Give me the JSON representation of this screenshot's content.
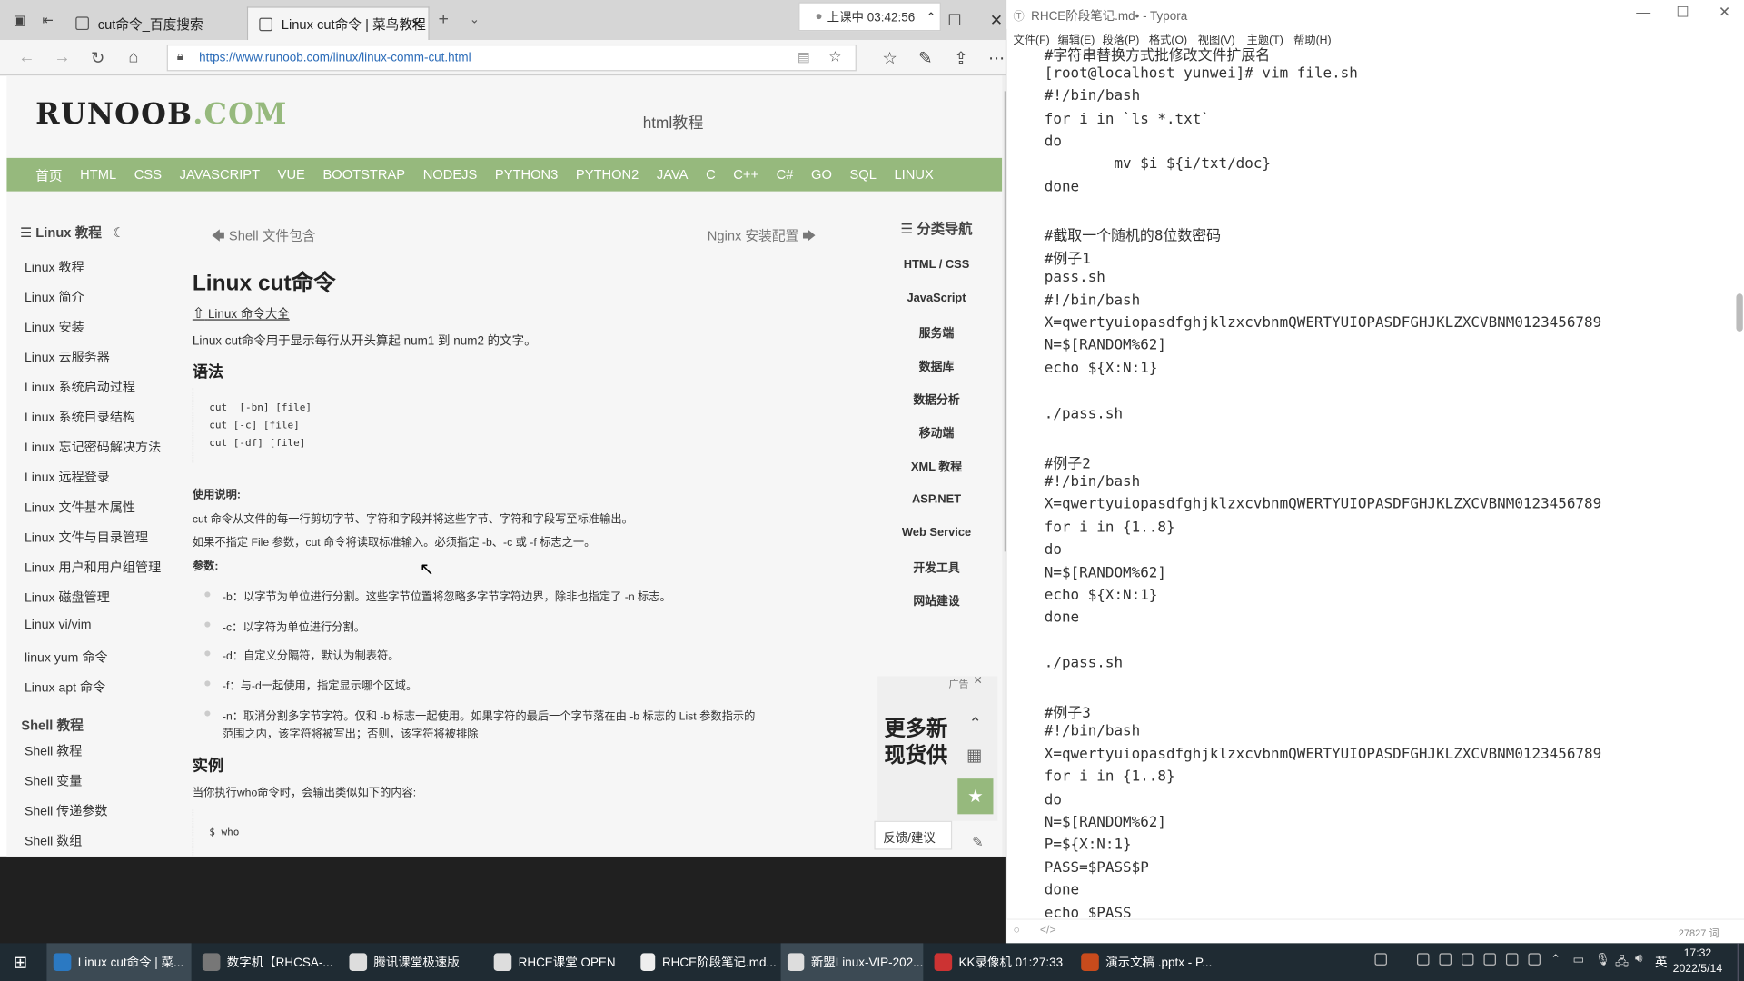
{
  "browser": {
    "tabs": [
      {
        "label": "cut命令_百度搜索"
      },
      {
        "label": "Linux cut命令 | 菜鸟教程"
      }
    ],
    "timer": "上课中 03:42:56",
    "url": "https://www.runoob.com/linux/linux-comm-cut.html"
  },
  "site": {
    "logo_main": "RUNOOB",
    "logo_suffix": ".COM",
    "header_link": "html教程",
    "nav": [
      "首页",
      "HTML",
      "CSS",
      "JAVASCRIPT",
      "VUE",
      "BOOTSTRAP",
      "NODEJS",
      "PYTHON3",
      "PYTHON2",
      "JAVA",
      "C",
      "C++",
      "C#",
      "GO",
      "SQL",
      "LINUX"
    ]
  },
  "sidebar": {
    "heading": "Linux 教程",
    "items": [
      "Linux 教程",
      "Linux 简介",
      "Linux 安装",
      "Linux 云服务器",
      "Linux 系统启动过程",
      "Linux 系统目录结构",
      "Linux 忘记密码解决方法",
      "Linux 远程登录",
      "Linux 文件基本属性",
      "Linux 文件与目录管理",
      "Linux 用户和用户组管理",
      "Linux 磁盘管理",
      "Linux vi/vim",
      "linux yum 命令",
      "Linux apt 命令"
    ],
    "heading2": "Shell 教程",
    "items2": [
      "Shell 教程",
      "Shell 变量",
      "Shell 传递参数",
      "Shell 数组"
    ]
  },
  "article": {
    "prev": "Shell 文件包含",
    "next": "Nginx 安装配置",
    "title": "Linux cut命令",
    "allcmds": "Linux 命令大全",
    "intro": "Linux cut命令用于显示每行从开头算起 num1 到 num2 的文字。",
    "syntax_heading": "语法",
    "syntax": [
      "cut  [-bn] [file]",
      "cut [-c] [file]",
      "cut [-df] [file]"
    ],
    "usage_heading": "使用说明:",
    "usage1": "cut 命令从文件的每一行剪切字节、字符和字段并将这些字节、字符和字段写至标准输出。",
    "usage2": "如果不指定 File 参数，cut 命令将读取标准输入。必须指定 -b、-c 或 -f 标志之一。",
    "params_heading": "参数:",
    "params": [
      "-b：以字节为单位进行分割。这些字节位置将忽略多字节字符边界，除非也指定了 -n 标志。",
      "-c：以字符为单位进行分割。",
      "-d：自定义分隔符，默认为制表符。",
      "-f：与-d一起使用，指定显示哪个区域。",
      "-n：取消分割多字节字符。仅和 -b 标志一起使用。如果字符的最后一个字节落在由 -b 标志的 List 参数指示的"
    ],
    "params_cont": "范围之内，该字符将被写出；否则，该字符将被排除",
    "example_heading": "实例",
    "example_intro": "当你执行who命令时，会输出类似如下的内容:",
    "example_code": "$ who"
  },
  "rightnav": {
    "heading": "分类导航",
    "items": [
      "HTML / CSS",
      "JavaScript",
      "服务端",
      "数据库",
      "数据分析",
      "移动端",
      "XML 教程",
      "ASP.NET",
      "Web Service",
      "开发工具",
      "网站建设"
    ],
    "ad_label": "广告",
    "ad_text1": "更多新",
    "ad_text2": "现货供",
    "feedback": "反馈/建议"
  },
  "typora": {
    "title": "RHCE阶段笔记.md• - Typora",
    "menu": [
      "文件(F)",
      "编辑(E)",
      "段落(P)",
      "格式(O)",
      "视图(V)",
      "主题(T)",
      "帮助(H)"
    ],
    "lines": [
      "#字符串替换方式批修改文件扩展名",
      "[root@localhost yunwei]# vim file.sh",
      "#!/bin/bash",
      "for i in `ls *.txt`",
      "do",
      "        mv $i ${i/txt/doc}",
      "done",
      "",
      "#截取一个随机的8位数密码",
      "#例子1",
      "pass.sh",
      "#!/bin/bash",
      "X=qwertyuiopasdfghjklzxcvbnmQWERTYUIOPASDFGHJKLZXCVBNM0123456789",
      "N=$[RANDOM%62]",
      "echo ${X:N:1}",
      "",
      "./pass.sh",
      "",
      "#例子2",
      "#!/bin/bash",
      "X=qwertyuiopasdfghjklzxcvbnmQWERTYUIOPASDFGHJKLZXCVBNM0123456789",
      "for i in {1..8}",
      "do",
      "N=$[RANDOM%62]",
      "echo ${X:N:1}",
      "done",
      "",
      "./pass.sh",
      "",
      "#例子3",
      "#!/bin/bash",
      "X=qwertyuiopasdfghjklzxcvbnmQWERTYUIOPASDFGHJKLZXCVBNM0123456789",
      "for i in {1..8}",
      "do",
      "N=$[RANDOM%62]",
      "P=${X:N:1}",
      "PASS=$PASS$P",
      "done",
      "echo $PASS"
    ],
    "word_count": "27827 词"
  },
  "taskbar": {
    "items": [
      "Linux cut命令 | 菜...",
      "数字机【RHCSA-...",
      "腾讯课堂极速版",
      "RHCE课堂 OPEN",
      "RHCE阶段笔记.md...",
      "新盟Linux-VIP-202...",
      "KK录像机 01:27:33",
      "演示文稿 .pptx - P..."
    ],
    "ime": "英",
    "time": "17:32",
    "date": "2022/5/14"
  }
}
